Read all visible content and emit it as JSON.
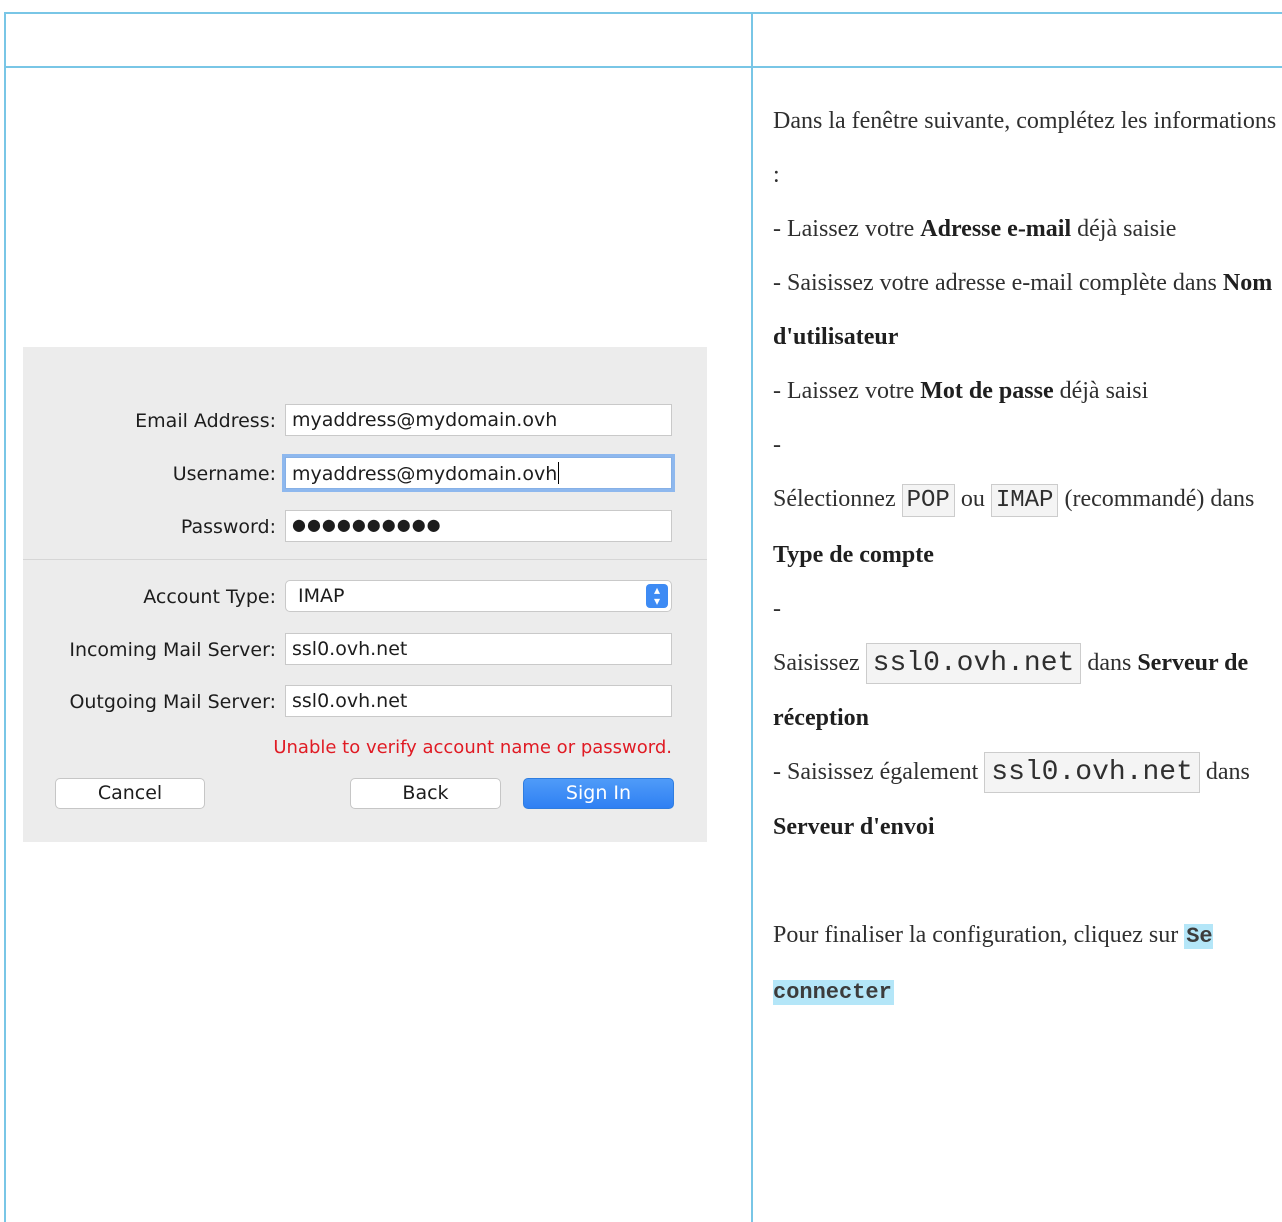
{
  "dialog": {
    "email_label": "Email Address:",
    "email_value": "myaddress@mydomain.ovh",
    "username_label": "Username:",
    "username_value": "myaddress@mydomain.ovh",
    "password_label": "Password:",
    "password_value": "●●●●●●●●●●",
    "account_type_label": "Account Type:",
    "account_type_value": "IMAP",
    "incoming_label": "Incoming Mail Server:",
    "incoming_value": "ssl0.ovh.net",
    "outgoing_label": "Outgoing Mail Server:",
    "outgoing_value": "ssl0.ovh.net",
    "error_text": "Unable to verify account name or password.",
    "cancel_label": "Cancel",
    "back_label": "Back",
    "signin_label": "Sign In",
    "select_icon": "chevron-updown-icon"
  },
  "instructions": {
    "intro": "Dans la fenêtre suivante, complétez les informations :",
    "item1_pre": "- Laissez votre ",
    "item1_bold": "Adresse e-mail",
    "item1_post": " déjà saisie",
    "item2_pre": "- Saisissez votre adresse e-mail complète dans ",
    "item2_bold": "Nom d'utilisateur",
    "item3_pre": "- Laissez votre ",
    "item3_bold": "Mot de passe",
    "item3_post": " déjà saisi",
    "item4_dash": "-",
    "item4_pre": "Sélectionnez ",
    "item4_code1": "POP",
    "item4_mid": " ou ",
    "item4_code2": "IMAP",
    "item4_post": " (recommandé) dans ",
    "item4_bold": "Type de compte",
    "item5_dash": "-",
    "item5_pre": "Saisissez ",
    "item5_code": "ssl0.ovh.net",
    "item5_mid": " dans ",
    "item5_bold": "Serveur de réception",
    "item6_pre": "- Saisissez également ",
    "item6_code": "ssl0.ovh.net",
    "item6_mid": " dans ",
    "item6_bold": "Serveur d'envoi",
    "final_pre": "Pour finaliser la configuration, cliquez sur ",
    "final_hl": "Se connecter"
  },
  "colors": {
    "table_border": "#79c6e6",
    "highlight": "#b4e6f8",
    "signin_blue": "#3487f5",
    "error_red": "#e01b24"
  }
}
